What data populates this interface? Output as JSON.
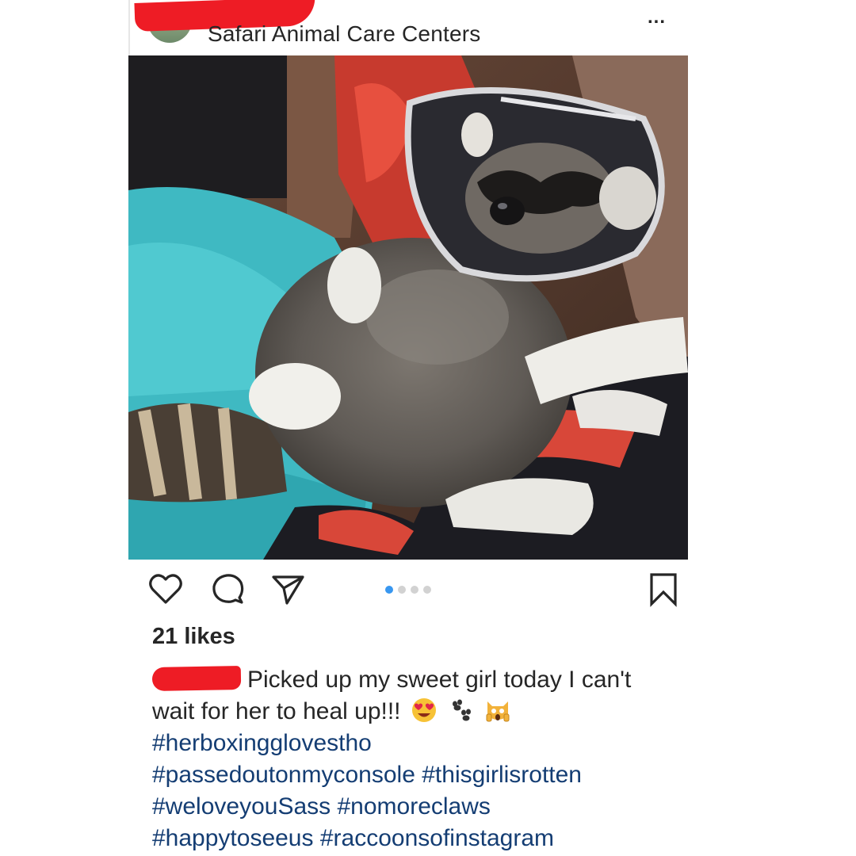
{
  "post": {
    "location": "Safari Animal Care Centers",
    "more_label": "...",
    "likes": "21 likes",
    "carousel": {
      "count": 4,
      "active": 1
    },
    "caption": {
      "text": "Picked up my sweet girl today I can't wait for her to heal up!!!",
      "emojis": [
        "heart-eyes-emoji",
        "paw-prints-emoji",
        "screaming-cat-emoji"
      ],
      "hashtags": [
        "#herboxinggloves­tho",
        "#passedoutonmyconsole",
        "#thisgirlisrotten",
        "#weloveyouSass",
        "#nomoreclaws",
        "#happytoseeus",
        "#raccoonsofinstagram"
      ]
    }
  },
  "icons": {
    "like": "heart-icon",
    "comment": "comment-icon",
    "share": "send-icon",
    "save": "bookmark-icon"
  },
  "colors": {
    "hashtag": "#143d73",
    "carousel_active": "#3897f0",
    "redaction": "#ee1c25"
  }
}
